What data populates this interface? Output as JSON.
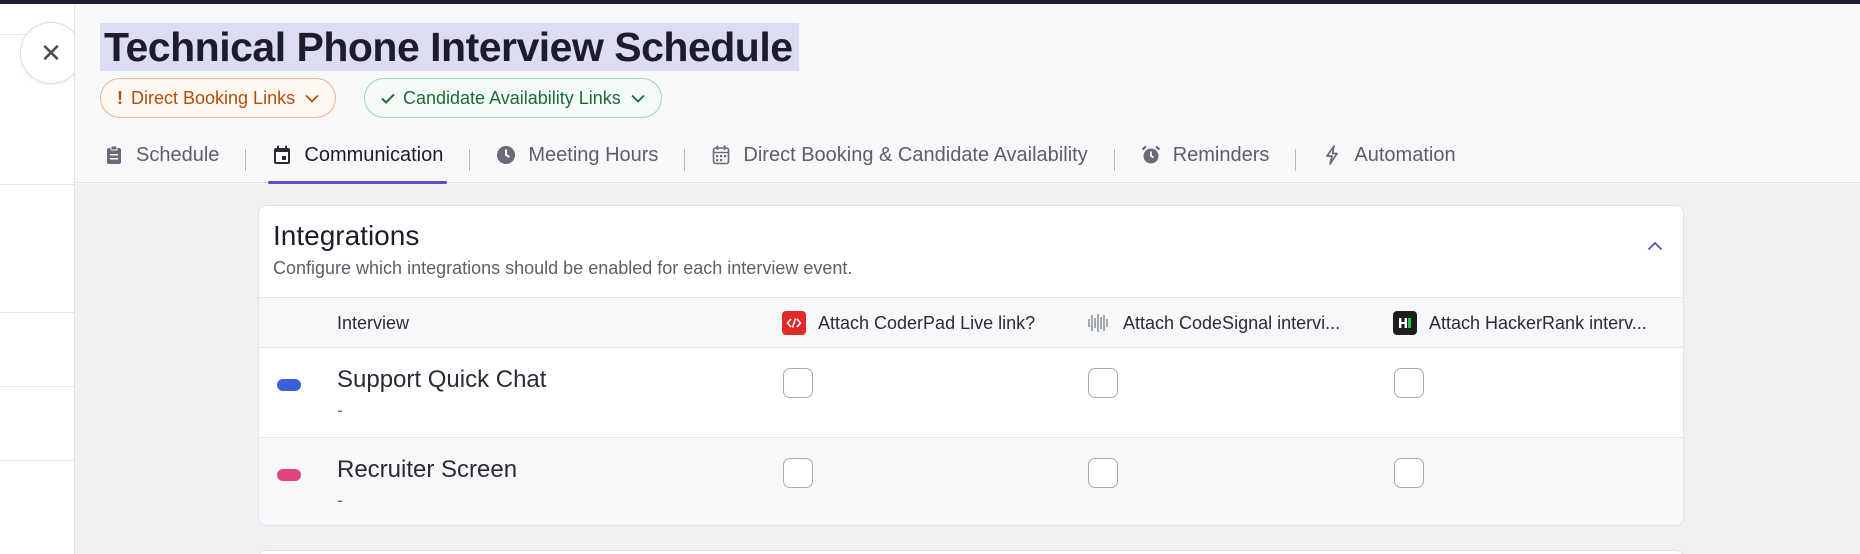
{
  "title": "Technical Phone Interview Schedule",
  "pills": {
    "direct_booking": {
      "icon": "!",
      "label": "Direct Booking Links"
    },
    "candidate_availability": {
      "label": "Candidate Availability Links"
    }
  },
  "tabs": [
    {
      "label": "Schedule",
      "icon": "clipboard-icon",
      "active": false
    },
    {
      "label": "Communication",
      "icon": "calendar-icon",
      "active": true
    },
    {
      "label": "Meeting Hours",
      "icon": "clock-icon",
      "active": false
    },
    {
      "label": "Direct Booking & Candidate Availability",
      "icon": "calendar-grid-icon",
      "active": false
    },
    {
      "label": "Reminders",
      "icon": "alarm-icon",
      "active": false
    },
    {
      "label": "Automation",
      "icon": "bolt-icon",
      "active": false
    }
  ],
  "card": {
    "title": "Integrations",
    "subtitle": "Configure which integrations should be enabled for each interview event."
  },
  "table": {
    "headers": {
      "interview": "Interview",
      "coderpad": "Attach CoderPad Live link?",
      "codesignal": "Attach CodeSignal intervi...",
      "hackerrank": "Attach HackerRank interv..."
    },
    "rows": [
      {
        "name": "Support Quick Chat",
        "sub": "-",
        "color": "#3b5fd6",
        "coderpad": false,
        "codesignal": false,
        "hackerrank": false
      },
      {
        "name": "Recruiter Screen",
        "sub": "-",
        "color": "#e0457f",
        "coderpad": false,
        "codesignal": false,
        "hackerrank": false
      }
    ]
  },
  "colors": {
    "accent": "#5b4ec7",
    "warning": "#b34e0a",
    "success": "#1d6b3c",
    "coderpad": "#e02a2a",
    "hackerrank": "#1e1e1e"
  }
}
